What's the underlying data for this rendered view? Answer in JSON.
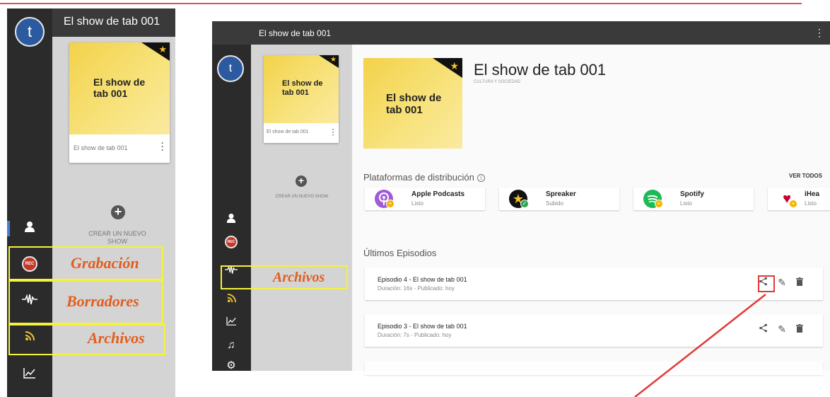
{
  "colors": {
    "accent_red": "#e03a3a",
    "annotation_yellow": "#f4f23a",
    "annotation_text": "#e25d1d",
    "cover_yellow": "#f3d24a",
    "rail_dark": "#2b2b2b"
  },
  "mobile": {
    "avatar_letter": "t",
    "header_title": "El show de tab 001",
    "card": {
      "cover_title": "El show de tab 001",
      "label": "El show de tab 001"
    },
    "create_label": "CREAR UN NUEVO SHOW",
    "rail_icons": [
      "user-icon",
      "rec-icon",
      "waveform-icon",
      "feed-icon",
      "chart-icon"
    ],
    "rec_text": "REC",
    "annotations": {
      "grabacion": "Grabación",
      "borradores": "Borradores",
      "archivos": "Archivos"
    }
  },
  "desktop": {
    "topbar_title": "El show de tab 001",
    "kebab": "⋮",
    "avatar_letter": "t",
    "rec_text": "REC",
    "rail_icons": [
      "user-icon",
      "rec-icon",
      "waveform-icon",
      "feed-icon",
      "chart-icon",
      "music-icon",
      "gear-icon"
    ],
    "card": {
      "cover_title": "El show de tab 001",
      "label": "El show de tab 001"
    },
    "create_label": "CREAR UN NUEVO SHOW",
    "annotation_archivos": "Archivos",
    "show": {
      "cover_title": "El show de tab 001",
      "title": "El show de tab 001",
      "category": "CULTURA Y SOCIEDAD"
    },
    "platforms_title": "Plataformas de distribución",
    "info_glyph": "i",
    "ver_todos": "VER TODOS",
    "platforms": [
      {
        "name": "Apple Podcasts",
        "status": "Listo",
        "color": "#a05cd6"
      },
      {
        "name": "Spreaker",
        "status": "Subido",
        "color": "#111111"
      },
      {
        "name": "Spotify",
        "status": "Listo",
        "color": "#1db954"
      },
      {
        "name": "iHea",
        "status": "Listo",
        "color": "#c6002b"
      }
    ],
    "episodes_title": "Últimos Episodios",
    "episodes": [
      {
        "title": "Episodio 4 - El show de tab 001",
        "meta": "Duración: 16s - Publicado: hoy"
      },
      {
        "title": "Episodio 3 - El show de tab 001",
        "meta": "Duración: 7s - Publicado: hoy"
      }
    ]
  }
}
